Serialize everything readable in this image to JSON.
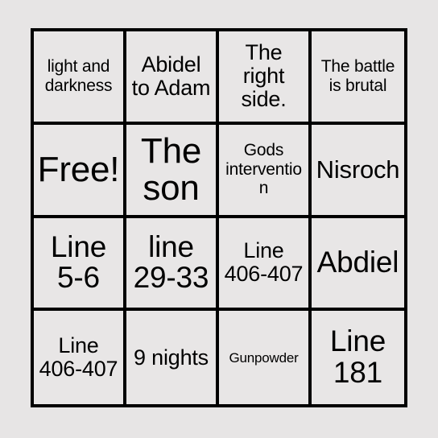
{
  "card": {
    "type": "bingo-card",
    "columns": 4,
    "rows": 4,
    "background_color": "#e7e5e5",
    "cell_color": "#e8e6e6",
    "border_color": "#000000",
    "text_color": "#000000",
    "cells": [
      {
        "text": "light and darkness",
        "size": "sm",
        "row": 1,
        "col": 1,
        "free_space": false
      },
      {
        "text": "Abidel to Adam",
        "size": "md",
        "row": 1,
        "col": 2,
        "free_space": false
      },
      {
        "text": "The right side.",
        "size": "md",
        "row": 1,
        "col": 3,
        "free_space": false
      },
      {
        "text": "The battle is brutal",
        "size": "sm",
        "row": 1,
        "col": 4,
        "free_space": false
      },
      {
        "text": "Free!",
        "size": "xxl",
        "row": 2,
        "col": 1,
        "free_space": true
      },
      {
        "text": "The son",
        "size": "xxl",
        "row": 2,
        "col": 2,
        "free_space": false
      },
      {
        "text": "Gods intervention",
        "size": "sm",
        "row": 2,
        "col": 3,
        "free_space": false
      },
      {
        "text": "Nisroch",
        "size": "lg",
        "row": 2,
        "col": 4,
        "free_space": false
      },
      {
        "text": "Line 5-6",
        "size": "xl",
        "row": 3,
        "col": 1,
        "free_space": false
      },
      {
        "text": "line 29-33",
        "size": "xl",
        "row": 3,
        "col": 2,
        "free_space": false
      },
      {
        "text": "Line 406-407",
        "size": "md",
        "row": 3,
        "col": 3,
        "free_space": false
      },
      {
        "text": "Abdiel",
        "size": "xl",
        "row": 3,
        "col": 4,
        "free_space": false
      },
      {
        "text": "Line 406-407",
        "size": "md",
        "row": 4,
        "col": 1,
        "free_space": false
      },
      {
        "text": "9 nights",
        "size": "md",
        "row": 4,
        "col": 2,
        "free_space": false
      },
      {
        "text": "Gunpowder",
        "size": "xs",
        "row": 4,
        "col": 3,
        "free_space": false
      },
      {
        "text": "Line 181",
        "size": "xl",
        "row": 4,
        "col": 4,
        "free_space": false
      }
    ]
  }
}
